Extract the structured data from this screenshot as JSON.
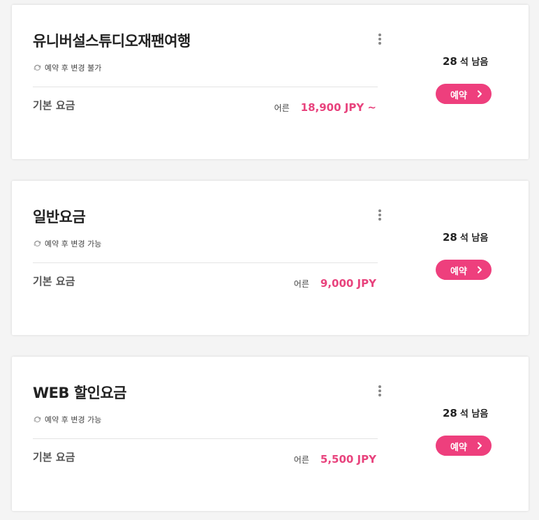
{
  "colors": {
    "accent": "#ee3f7d",
    "price": "#e8437d",
    "background": "#f4f4f4"
  },
  "cards": [
    {
      "title": "유니버설스튜디오재팬여행",
      "note": "예약 후 변경 불가",
      "fare_label": "기본 요금",
      "age_label": "어른",
      "price": "18,900 JPY ~",
      "seats_count": "28",
      "seats_unit": "석 남음",
      "book_label": "예약",
      "icons": {
        "note": "change-icon",
        "more": "more-vertical-icon",
        "chevron": "chevron-right-icon"
      }
    },
    {
      "title": "일반요금",
      "note": "예약 후 변경 가능",
      "fare_label": "기본 요금",
      "age_label": "어른",
      "price": "9,000 JPY",
      "seats_count": "28",
      "seats_unit": "석 남음",
      "book_label": "예약",
      "icons": {
        "note": "change-icon",
        "more": "more-vertical-icon",
        "chevron": "chevron-right-icon"
      }
    },
    {
      "title": "WEB 할인요금",
      "note": "예약 후 변경 가능",
      "fare_label": "기본 요금",
      "age_label": "어른",
      "price": "5,500 JPY",
      "seats_count": "28",
      "seats_unit": "석 남음",
      "book_label": "예약",
      "icons": {
        "note": "change-icon",
        "more": "more-vertical-icon",
        "chevron": "chevron-right-icon"
      }
    }
  ]
}
